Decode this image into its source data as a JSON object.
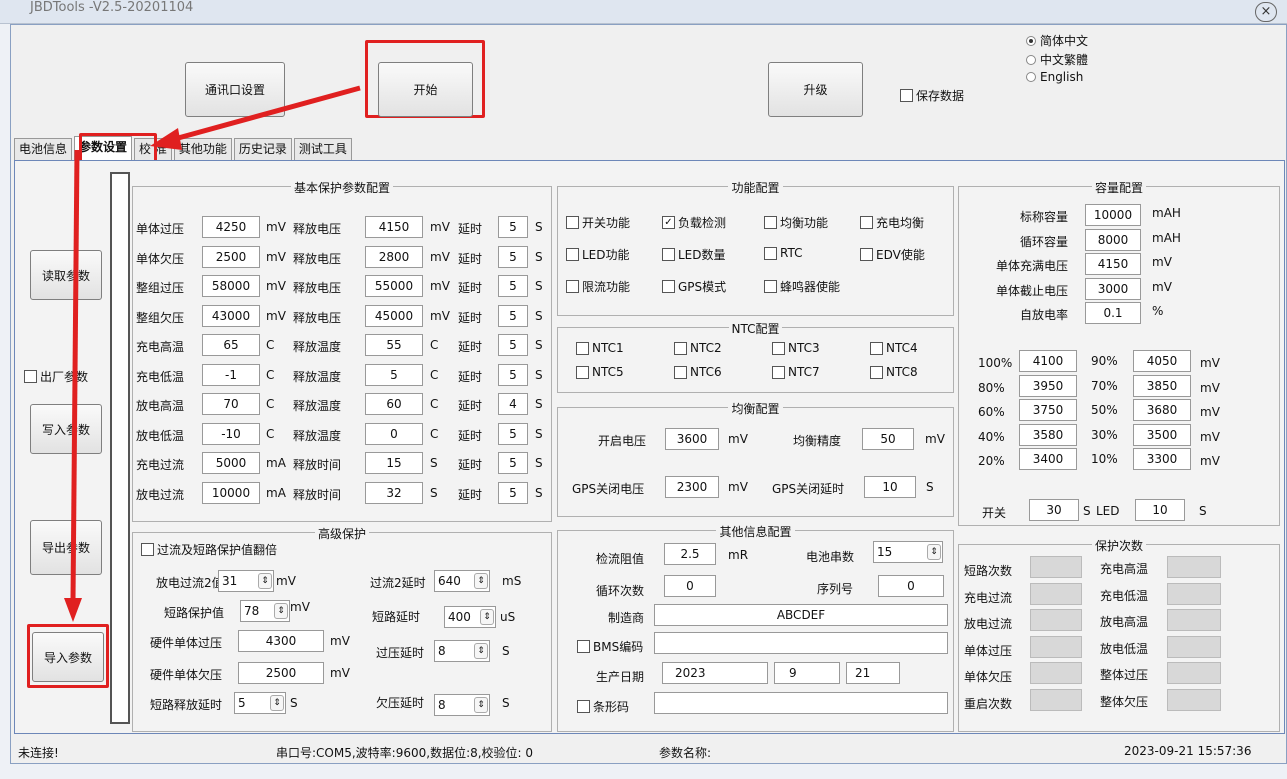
{
  "window": {
    "title": "JBDTools -V2.5-20201104",
    "close": "×"
  },
  "top": {
    "comm_btn": "通讯口设置",
    "start_btn": "开始",
    "upgrade_btn": "升级",
    "save_data": "保存数据"
  },
  "lang": {
    "options": [
      "简体中文",
      "中文繁體",
      "English"
    ],
    "selected": 0
  },
  "tabs": [
    "电池信息",
    "参数设置",
    "校 准",
    "其他功能",
    "历史记录",
    "测试工具"
  ],
  "side": {
    "read": "读取参数",
    "factory": "出厂参数",
    "write": "写入参数",
    "export": "导出参数",
    "import": "导入参数"
  },
  "basic": {
    "title": "基本保护参数配置",
    "rows": [
      {
        "n": "单体过压",
        "v": "4250",
        "u": "mV",
        "r": "释放电压",
        "rv": "4150",
        "ru": "mV",
        "d": "延时",
        "dv": "5",
        "du": "S"
      },
      {
        "n": "单体欠压",
        "v": "2500",
        "u": "mV",
        "r": "释放电压",
        "rv": "2800",
        "ru": "mV",
        "d": "延时",
        "dv": "5",
        "du": "S"
      },
      {
        "n": "整组过压",
        "v": "58000",
        "u": "mV",
        "r": "释放电压",
        "rv": "55000",
        "ru": "mV",
        "d": "延时",
        "dv": "5",
        "du": "S"
      },
      {
        "n": "整组欠压",
        "v": "43000",
        "u": "mV",
        "r": "释放电压",
        "rv": "45000",
        "ru": "mV",
        "d": "延时",
        "dv": "5",
        "du": "S"
      },
      {
        "n": "充电高温",
        "v": "65",
        "u": "C",
        "r": "释放温度",
        "rv": "55",
        "ru": "C",
        "d": "延时",
        "dv": "5",
        "du": "S"
      },
      {
        "n": "充电低温",
        "v": "-1",
        "u": "C",
        "r": "释放温度",
        "rv": "5",
        "ru": "C",
        "d": "延时",
        "dv": "5",
        "du": "S"
      },
      {
        "n": "放电高温",
        "v": "70",
        "u": "C",
        "r": "释放温度",
        "rv": "60",
        "ru": "C",
        "d": "延时",
        "dv": "4",
        "du": "S"
      },
      {
        "n": "放电低温",
        "v": "-10",
        "u": "C",
        "r": "释放温度",
        "rv": "0",
        "ru": "C",
        "d": "延时",
        "dv": "5",
        "du": "S"
      },
      {
        "n": "充电过流",
        "v": "5000",
        "u": "mA",
        "r": "释放时间",
        "rv": "15",
        "ru": "S",
        "d": "延时",
        "dv": "5",
        "du": "S"
      },
      {
        "n": "放电过流",
        "v": "10000",
        "u": "mA",
        "r": "释放时间",
        "rv": "32",
        "ru": "S",
        "d": "延时",
        "dv": "5",
        "du": "S"
      }
    ]
  },
  "func": {
    "title": "功能配置",
    "items": [
      {
        "l": "开关功能",
        "c": false
      },
      {
        "l": "负载检测",
        "c": true
      },
      {
        "l": "均衡功能",
        "c": false
      },
      {
        "l": "充电均衡",
        "c": false
      },
      {
        "l": "LED功能",
        "c": false
      },
      {
        "l": "LED数量",
        "c": false
      },
      {
        "l": "RTC",
        "c": false
      },
      {
        "l": "EDV使能",
        "c": false
      },
      {
        "l": "限流功能",
        "c": false
      },
      {
        "l": "GPS模式",
        "c": false
      },
      {
        "l": "蜂鸣器使能",
        "c": false
      }
    ]
  },
  "ntc": {
    "title": "NTC配置",
    "items": [
      "NTC1",
      "NTC2",
      "NTC3",
      "NTC4",
      "NTC5",
      "NTC6",
      "NTC7",
      "NTC8"
    ]
  },
  "bal": {
    "title": "均衡配置",
    "open_l": "开启电压",
    "open_v": "3600",
    "open_u": "mV",
    "acc_l": "均衡精度",
    "acc_v": "50",
    "acc_u": "mV",
    "gps_l": "GPS关闭电压",
    "gps_v": "2300",
    "gps_u": "mV",
    "gpsd_l": "GPS关闭延时",
    "gpsd_v": "10",
    "gpsd_u": "S"
  },
  "cap": {
    "title": "容量配置",
    "rows": [
      {
        "l": "标称容量",
        "v": "10000",
        "u": "mAH"
      },
      {
        "l": "循环容量",
        "v": "8000",
        "u": "mAH"
      },
      {
        "l": "单体充满电压",
        "v": "4150",
        "u": "mV"
      },
      {
        "l": "单体截止电压",
        "v": "3000",
        "u": "mV"
      },
      {
        "l": "自放电率",
        "v": "0.1",
        "u": "%"
      }
    ],
    "pct": [
      {
        "a": "100%",
        "av": "4100",
        "b": "90%",
        "bv": "4050"
      },
      {
        "a": "80%",
        "av": "3950",
        "b": "70%",
        "bv": "3850"
      },
      {
        "a": "60%",
        "av": "3750",
        "b": "50%",
        "bv": "3680"
      },
      {
        "a": "40%",
        "av": "3580",
        "b": "30%",
        "bv": "3500"
      },
      {
        "a": "20%",
        "av": "3400",
        "b": "10%",
        "bv": "3300"
      }
    ],
    "pu": "mV",
    "sw_l": "开关",
    "sw_v": "30",
    "sw_u": "S",
    "led_l": "LED",
    "led_v": "10",
    "led_u": "S"
  },
  "adv": {
    "title": "高级保护",
    "dbl": "过流及短路保护值翻倍",
    "dis2_l": "放电过流2值",
    "dis2_v": "31",
    "dis2_u": "mV",
    "oc2d_l": "过流2延时",
    "oc2d_v": "640",
    "oc2d_u": "mS",
    "sc_l": "短路保护值",
    "sc_v": "78",
    "sc_u": "mV",
    "scd_l": "短路延时",
    "scd_v": "400",
    "scd_u": "uS",
    "hov_l": "硬件单体过压",
    "hov_v": "4300",
    "hov_u": "mV",
    "ovd_l": "过压延时",
    "ovd_v": "8",
    "ovd_u": "S",
    "huv_l": "硬件单体欠压",
    "huv_v": "2500",
    "huv_u": "mV",
    "scr_l": "短路释放延时",
    "scr_v": "5",
    "scr_u": "S",
    "uvd_l": "欠压延时",
    "uvd_v": "8",
    "uvd_u": "S"
  },
  "other": {
    "title": "其他信息配置",
    "res_l": "检流阻值",
    "res_v": "2.5",
    "res_u": "mR",
    "cells_l": "电池串数",
    "cells_v": "15",
    "cyc_l": "循环次数",
    "cyc_v": "0",
    "sn_l": "序列号",
    "sn_v": "0",
    "mfr_l": "制造商",
    "mfr_v": "ABCDEF",
    "bms_l": "BMS编码",
    "date_l": "生产日期",
    "y": "2023",
    "m": "9",
    "d": "21",
    "bar_l": "条形码"
  },
  "prot": {
    "title": "保护次数",
    "left": [
      "短路次数",
      "充电过流",
      "放电过流",
      "单体过压",
      "单体欠压",
      "重启次数"
    ],
    "right": [
      "充电高温",
      "充电低温",
      "放电高温",
      "放电低温",
      "整体过压",
      "整体欠压"
    ]
  },
  "status": {
    "conn": "未连接!",
    "port": "串口号:COM5,波特率:9600,数据位:8,校验位: 0",
    "pname": "参数名称:",
    "time": "2023-09-21 15:57:36"
  }
}
